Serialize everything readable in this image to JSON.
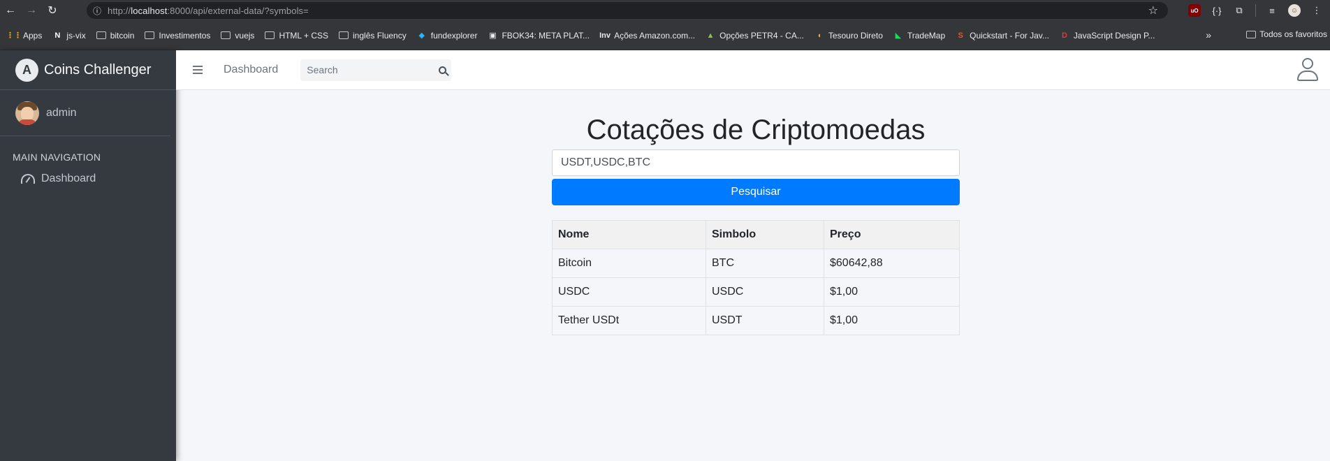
{
  "browser": {
    "url_prefix": "http://",
    "url_host": "localhost",
    "url_rest": ":8000/api/external-data/?symbols=",
    "bookmarks": [
      {
        "label": "Apps",
        "icon": "apps-grid-icon"
      },
      {
        "label": "js-vix",
        "icon": "notion-icon"
      },
      {
        "label": "bitcoin",
        "icon": "folder-icon"
      },
      {
        "label": "Investimentos",
        "icon": "folder-icon"
      },
      {
        "label": "vuejs",
        "icon": "folder-icon"
      },
      {
        "label": "HTML + CSS",
        "icon": "folder-icon"
      },
      {
        "label": "inglês Fluency",
        "icon": "folder-icon"
      },
      {
        "label": "fundexplorer",
        "icon": "fundexplorer-icon"
      },
      {
        "label": "FBOK34: META PLAT...",
        "icon": "site-icon"
      },
      {
        "label": "Ações Amazon.com...",
        "icon": "investing-icon"
      },
      {
        "label": "Opções PETR4 - CA...",
        "icon": "chart-icon"
      },
      {
        "label": "Tesouro Direto",
        "icon": "tesouro-icon"
      },
      {
        "label": "TradeMap",
        "icon": "trademap-icon"
      },
      {
        "label": "Quickstart - For Jav...",
        "icon": "quickstart-icon"
      },
      {
        "label": "JavaScript Design P...",
        "icon": "design-patterns-icon"
      }
    ],
    "more_label": "»",
    "other_bookmarks": "Todos os favoritos"
  },
  "sidebar": {
    "brand": "Coins Challenger",
    "user": "admin",
    "nav_header": "MAIN NAVIGATION",
    "items": [
      {
        "label": "Dashboard",
        "icon": "tachometer-icon"
      }
    ]
  },
  "topbar": {
    "link": "Dashboard",
    "search_placeholder": "Search"
  },
  "main": {
    "title": "Cotações de Criptomoedas",
    "symbols_value": "USDT,USDC,BTC",
    "button_label": "Pesquisar",
    "table": {
      "headers": [
        "Nome",
        "Simbolo",
        "Preço"
      ],
      "rows": [
        [
          "Bitcoin",
          "BTC",
          "$60642,88"
        ],
        [
          "USDC",
          "USDC",
          "$1,00"
        ],
        [
          "Tether USDt",
          "USDT",
          "$1,00"
        ]
      ]
    }
  },
  "colors": {
    "primary": "#007bff",
    "sidebar": "#343a40"
  }
}
